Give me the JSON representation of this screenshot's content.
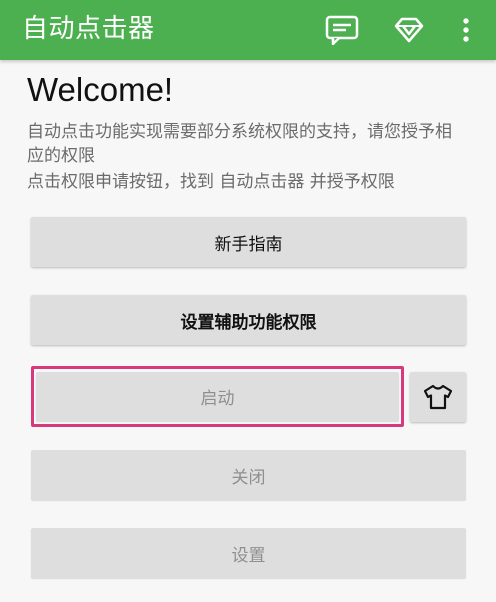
{
  "app_bar": {
    "title": "自动点击器",
    "icons": [
      "feedback-icon",
      "diamond-icon",
      "more-vert-icon"
    ]
  },
  "main": {
    "welcome": "Welcome!",
    "description": "自动点击功能实现需要部分系统权限的支持，请您授予相应的权限",
    "instruction": "点击权限申请按钮，找到 自动点击器 并授予权限"
  },
  "buttons": {
    "guide": "新手指南",
    "accessibility_permission": "设置辅助功能权限",
    "start": "启动",
    "close": "关闭",
    "settings": "设置"
  },
  "colors": {
    "app_bar": "#4caf50",
    "highlight_border": "#d63a7c",
    "button_bg": "#dedede"
  }
}
